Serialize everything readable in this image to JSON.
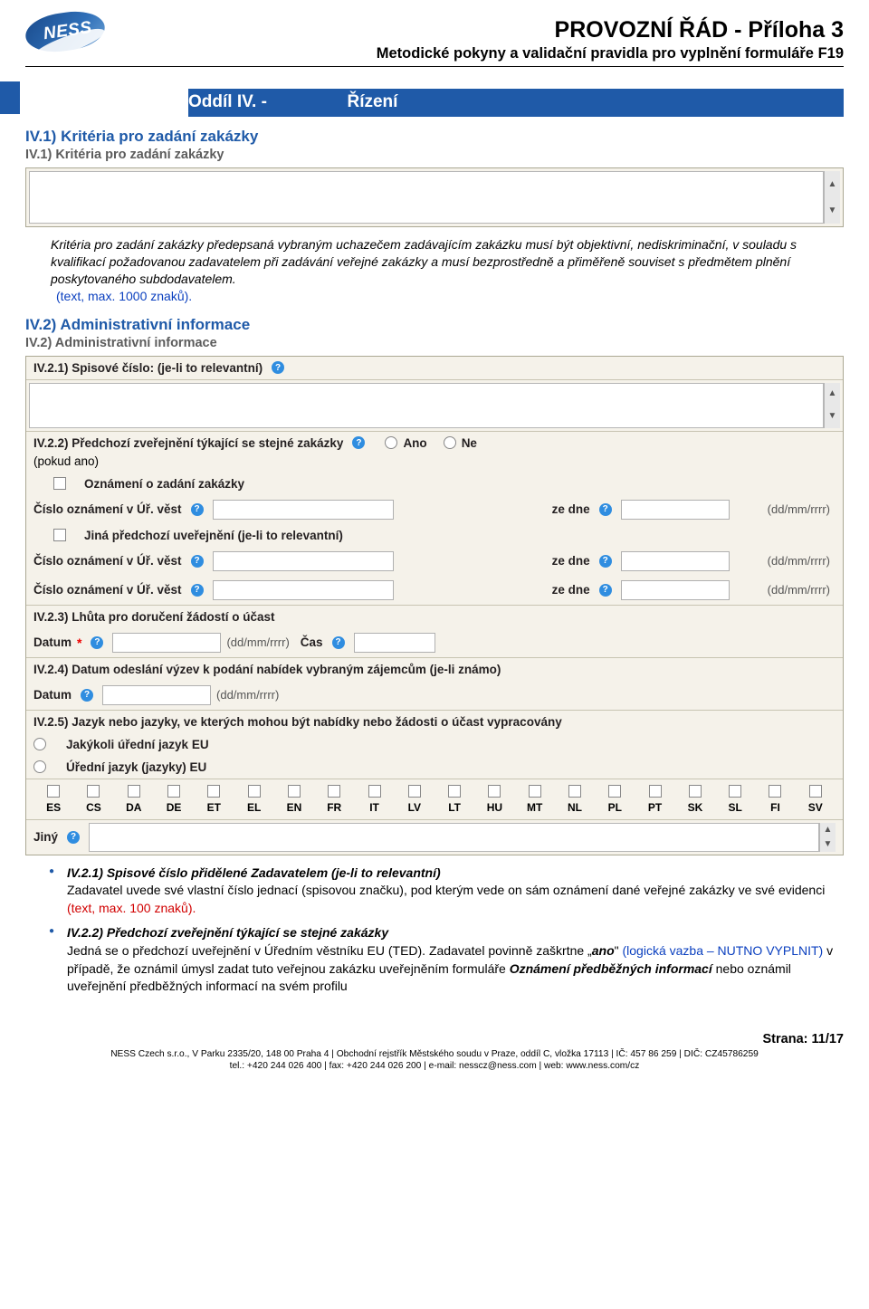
{
  "header": {
    "logo_text": "NESS",
    "title": "PROVOZNÍ ŘÁD - Příloha 3",
    "subtitle": "Metodické pokyny a validační pravidla pro vyplnění formuláře F19"
  },
  "banner": {
    "left": "Oddíl IV. -",
    "right": "Řízení"
  },
  "s1": {
    "heading": "IV.1) Kritéria pro zadání zakázky",
    "grey": "IV.1) Kritéria pro zadání zakázky",
    "para": "Kritéria pro zadání zakázky předepsaná vybraným uchazečem zadávajícím zakázku musí být objektivní, nediskriminační, v souladu s kvalifikací požadovanou zadavatelem při zadávání veřejné zakázky a musí bezprostředně a přiměřeně souviset s předmětem plnění poskytovaného subdodavatelem.",
    "note": "(text, max. 1000 znaků)."
  },
  "s2": {
    "heading": "IV.2) Administrativní informace",
    "grey": "IV.2) Administrativní informace",
    "r221": "IV.2.1) Spisové číslo: (je-li to relevantní)",
    "r222": "IV.2.2) Předchozí zveřejnění týkající se stejné zakázky",
    "ano": "Ano",
    "ne": "Ne",
    "pokud": "(pokud ano)",
    "ozn": "Oznámení o zadání zakázky",
    "cislo": "Číslo oznámení v Úř. věst",
    "zedne": "ze dne",
    "ddmm": "(dd/mm/rrrr)",
    "jina": "Jiná předchozí uveřejnění (je-li to relevantní)",
    "r223": "IV.2.3) Lhůta pro doručení žádostí o účast",
    "datum": "Datum",
    "cas": "Čas",
    "r224": "IV.2.4) Datum odeslání výzev k podání nabídek vybraným zájemcům (je-li známo)",
    "r225": "IV.2.5) Jazyk nebo jazyky, ve kterých mohou být nabídky nebo žádosti o účast vypracovány",
    "lang_opt1": "Jakýkoli úřední jazyk EU",
    "lang_opt2": "Úřední jazyk (jazyky) EU",
    "langs": [
      "ES",
      "CS",
      "DA",
      "DE",
      "ET",
      "EL",
      "EN",
      "FR",
      "IT",
      "LV",
      "LT",
      "HU",
      "MT",
      "NL",
      "PL",
      "PT",
      "SK",
      "SL",
      "FI",
      "SV"
    ],
    "jiny": "Jiný"
  },
  "bul": {
    "b1_title": "IV.2.1) Spisové číslo přidělené Zadavatelem (je-li to relevantní)",
    "b1_text1": "Zadavatel uvede své vlastní číslo jednací (spisovou značku), pod kterým vede on sám oznámení dané veřejné zakázky ve své evidenci ",
    "b1_note": "(text, max. 100 znaků).",
    "b2_title": "IV.2.2) Předchozí zveřejnění týkající se stejné zakázky",
    "b2_text1": "Jedná se o předchozí uveřejnění v Úředním věstníku EU (TED). Zadavatel povinně zaškrtne „",
    "b2_ano": "ano",
    "b2_text2": "\" ",
    "b2_logic": "(logická vazba – NUTNO VYPLNIT)",
    "b2_text3": " v případě, že oznámil úmysl zadat tuto veřejnou zakázku uveřejněním formuláře ",
    "b2_form": "Oznámení předběžných informací",
    "b2_text4": " nebo oznámil uveřejnění předběžných informací na svém profilu"
  },
  "footer": {
    "strana": "Strana: 11/17",
    "line1": "NESS Czech s.r.o., V Parku 2335/20, 148 00 Praha 4 | Obchodní rejstřík Městského soudu v Praze, oddíl C, vložka 17113 | IČ: 457 86 259 | DIČ: CZ45786259",
    "line2": "tel.: +420 244 026 400 | fax: +420 244 026 200 | e-mail: nesscz@ness.com | web: www.ness.com/cz"
  }
}
